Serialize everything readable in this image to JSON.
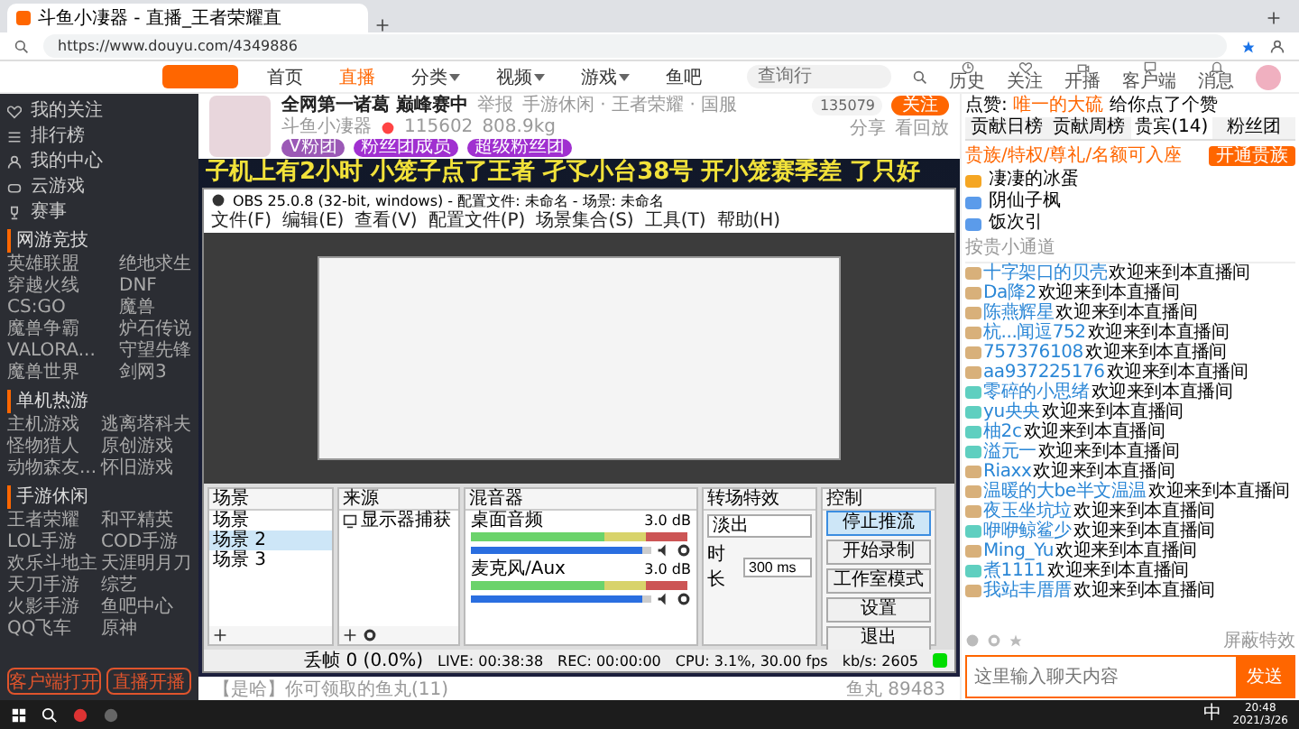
{
  "browser": {
    "tab_title": "斗鱼小凄器 - 直播_王者荣耀直",
    "url": "https://www.douyu.com/4349886"
  },
  "site_nav": [
    {
      "label": "首页",
      "selected": false,
      "has_menu": false
    },
    {
      "label": "直播",
      "selected": true,
      "has_menu": false
    },
    {
      "label": "分类",
      "selected": false,
      "has_menu": true
    },
    {
      "label": "视频",
      "selected": false,
      "has_menu": true
    },
    {
      "label": "游戏",
      "selected": false,
      "has_menu": true
    },
    {
      "label": "鱼吧",
      "selected": false,
      "has_menu": false
    }
  ],
  "search": {
    "placeholder": "查询行"
  },
  "header_actions": [
    {
      "label": "历史",
      "kind": "clock"
    },
    {
      "label": "关注",
      "kind": "heart"
    },
    {
      "label": "开播",
      "kind": "camera"
    },
    {
      "label": "客户端",
      "kind": "chat"
    },
    {
      "label": "消息",
      "kind": "bell"
    }
  ],
  "sidebar": {
    "links": [
      {
        "label": "我的关注",
        "kind": "heart"
      },
      {
        "label": "排行榜",
        "kind": "list"
      },
      {
        "label": "我的中心",
        "kind": "user"
      },
      {
        "label": "云游戏",
        "kind": "gamepad"
      },
      {
        "label": "赛事",
        "kind": "trophy"
      }
    ],
    "sections": [
      {
        "title": "网游竞技",
        "items": [
          "英雄联盟",
          "绝地求生",
          "穿越火线",
          "DNF",
          "CS:GO",
          "魔兽",
          "魔兽争霸",
          "炉石传说",
          "VALORA...",
          "守望先锋",
          "魔兽世界",
          "剑网3"
        ]
      },
      {
        "title": "单机热游",
        "items": [
          "主机游戏",
          "逃离塔科夫",
          "怪物猎人",
          "原创游戏",
          "动物森友...",
          "怀旧游戏"
        ]
      },
      {
        "title": "手游休闲",
        "items": [
          "王者荣耀",
          "和平精英",
          "LOL手游",
          "COD手游",
          "欢乐斗地主",
          "天涯明月刀",
          "天刀手游",
          "综艺",
          "火影手游",
          "鱼吧中心",
          "QQ飞车",
          "原神"
        ]
      }
    ],
    "buttons": [
      "客户端打开",
      "直播开播"
    ]
  },
  "stream": {
    "title": "全网第一诸葛 巅峰赛中",
    "report": "举报",
    "category": "手游休闲 · 王者荣耀 · 国服",
    "anchor": "斗鱼小凄器",
    "hot": "115602",
    "weight": "808.9kg",
    "buttons": [
      "V粉团",
      "粉丝团成员",
      "超级粉丝团"
    ],
    "followers": "135079",
    "follow": "关注",
    "actions": [
      "分享",
      "看回放"
    ],
    "subtitle": "子机上有2小时 小笼子点了王者 孑孓小台38号 开小笼赛季差 了只好"
  },
  "obs": {
    "title": "OBS 25.0.8 (32-bit, windows) - 配置文件: 未命名 - 场景: 未命名",
    "menu": [
      "文件(F)",
      "编辑(E)",
      "查看(V)",
      "配置文件(P)",
      "场景集合(S)",
      "工具(T)",
      "帮助(H)"
    ],
    "scenes": {
      "title": "场景",
      "items": [
        {
          "label": "场景",
          "selected": false
        },
        {
          "label": "场景 2",
          "selected": true
        },
        {
          "label": "场景 3",
          "selected": false
        }
      ]
    },
    "sources": {
      "title": "来源",
      "items": [
        "显示器捕获"
      ]
    },
    "mixer": {
      "title": "混音器",
      "channels": [
        {
          "name": "桌面音频",
          "reading": "3.0 dB",
          "level": 0.95
        },
        {
          "name": "麦克风/Aux",
          "reading": "3.0 dB",
          "level": 0.95
        }
      ]
    },
    "transitions": {
      "title": "转场特效",
      "effect": "淡出",
      "duration_label": "时长",
      "duration": "300 ms"
    },
    "controls": {
      "title": "控制",
      "buttons": [
        {
          "label": "停止推流",
          "selected": true
        },
        {
          "label": "开始录制",
          "selected": false
        },
        {
          "label": "工作室模式",
          "selected": false
        },
        {
          "label": "设置",
          "selected": false
        },
        {
          "label": "退出",
          "selected": false
        }
      ]
    },
    "status": [
      "丢帧 0 (0.0%)",
      "LIVE: 00:38:38",
      "REC: 00:00:00",
      "CPU: 3.1%, 30.00 fps",
      "kb/s: 2605"
    ]
  },
  "below_video": {
    "notice": "【是哈】你可领取的鱼丸(11)",
    "fish": "鱼丸 89483"
  },
  "chat": {
    "like_prefix": "点赞:",
    "like_user": "唯一的大硫",
    "like_suffix": "给你点了个赞",
    "tabs": [
      {
        "label": "贡献日榜",
        "selected": false
      },
      {
        "label": "贡献周榜",
        "selected": false
      },
      {
        "label": "贵宾(14)",
        "selected": true
      },
      {
        "label": "粉丝团",
        "selected": false
      }
    ],
    "vip_note": "贵族/特权/尊礼/名额可入座",
    "vip_button": "开通贵族",
    "vips": [
      {
        "name": "凄凄的冰蛋",
        "color": "#f5a623"
      },
      {
        "name": "阴仙子枫",
        "color": "#5b9bea"
      },
      {
        "name": "饭次引",
        "color": "#5b9bea"
      }
    ],
    "vip_more": "按贵小通道",
    "messages": [
      {
        "user": "十字架口的贝壳",
        "text": "欢迎来到本直播间",
        "color": "#d8b07a"
      },
      {
        "user": "Da降2",
        "text": "欢迎来到本直播间",
        "color": "#d8b07a"
      },
      {
        "user": "陈燕辉星",
        "text": "欢迎来到本直播间",
        "color": "#d8b07a"
      },
      {
        "user": "杭...闻逗752",
        "text": "欢迎来到本直播间",
        "color": "#d8b07a"
      },
      {
        "user": "757376108",
        "text": "欢迎来到本直播间",
        "color": "#d8b07a"
      },
      {
        "user": "aa937225176",
        "text": "欢迎来到本直播间",
        "color": "#d8b07a"
      },
      {
        "user": "零碎的小思绪",
        "text": "欢迎来到本直播间",
        "color": "#5fcfc0"
      },
      {
        "user": "yu央央",
        "text": "欢迎来到本直播间",
        "color": "#5fcfc0"
      },
      {
        "user": "柚2c",
        "text": "欢迎来到本直播间",
        "color": "#5fcfc0"
      },
      {
        "user": "溢元一",
        "text": "欢迎来到本直播间",
        "color": "#5fcfc0"
      },
      {
        "user": "Riaxx",
        "text": "欢迎来到本直播间",
        "color": "#d8b07a"
      },
      {
        "user": "温暖的大be半文温温",
        "text": "欢迎来到本直播间",
        "color": "#d8b07a"
      },
      {
        "user": "夜玉坐坑垃",
        "text": "欢迎来到本直播间",
        "color": "#d8b07a"
      },
      {
        "user": "咿咿鲸鲨少",
        "text": "欢迎来到本直播间",
        "color": "#5fcfc0"
      },
      {
        "user": "Ming_Yu",
        "text": "欢迎来到本直播间",
        "color": "#d8b07a"
      },
      {
        "user": "煮1111",
        "text": "欢迎来到本直播间",
        "color": "#5fcfc0"
      },
      {
        "user": "我站丰厝厝",
        "text": "欢迎来到本直播间",
        "color": "#d8b07a"
      }
    ],
    "shield": "屏蔽特效",
    "input_placeholder": "这里输入聊天内容",
    "send": "发送"
  },
  "taskbar": {
    "ime": "中",
    "time": "20:48",
    "date": "2021/3/26"
  }
}
